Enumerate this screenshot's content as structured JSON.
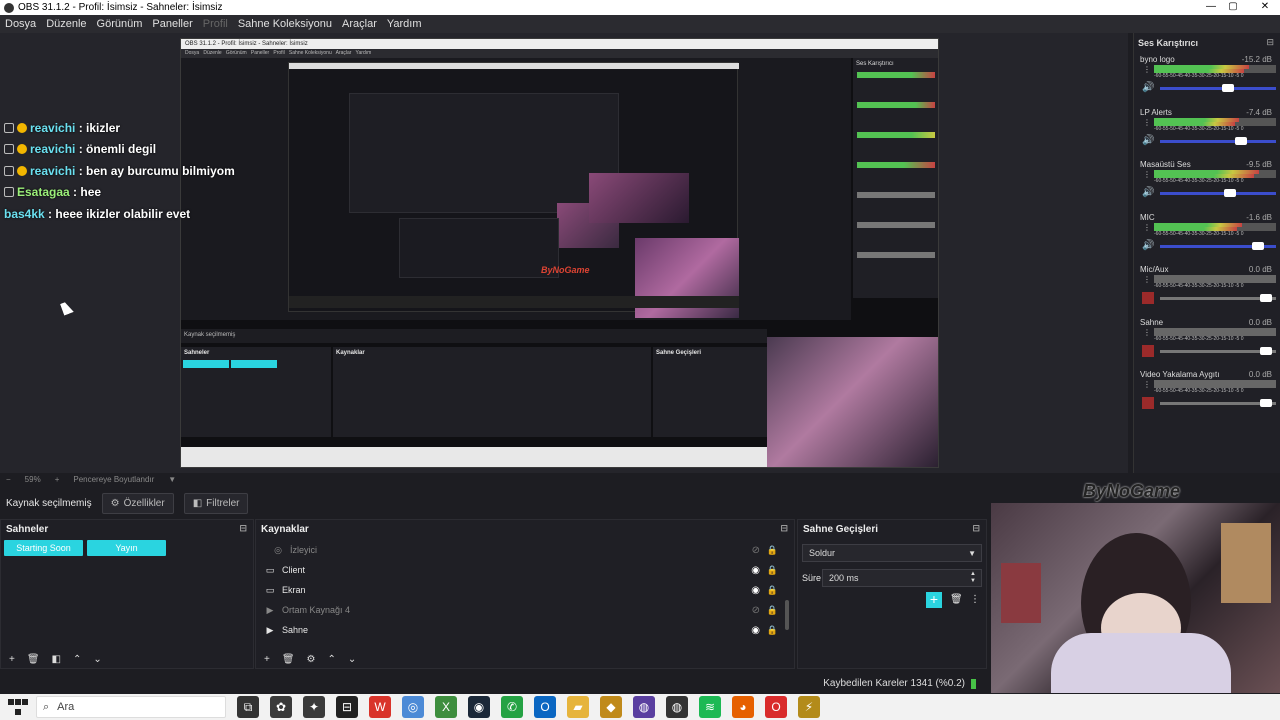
{
  "window": {
    "title": "OBS 31.1.2 - Profil: İsimsiz - Sahneler: İsimsiz",
    "controls": {
      "minimize": "—",
      "maximize": "▢",
      "close": "✕"
    }
  },
  "menu": {
    "items": [
      "Dosya",
      "Düzenle",
      "Görünüm",
      "Paneller",
      "Profil",
      "Sahne Koleksiyonu",
      "Araçlar",
      "Yardım"
    ]
  },
  "chat": [
    {
      "user": "reavichi",
      "text": ": ikizler"
    },
    {
      "user": "reavichi",
      "text": ": önemli degil"
    },
    {
      "user": "reavichi",
      "text": ": ben ay burcumu bilmiyom"
    },
    {
      "user": "Esatagaa",
      "text": ": hee"
    },
    {
      "user": "bas4kk",
      "text": ": heee ikizler olabilir evet"
    }
  ],
  "mixer": {
    "title": "Ses Karıştırıcı",
    "ticks": "-60-55-50-45-40-35-30-25-20-15-10 -5  0",
    "channels": [
      {
        "name": "byno logo",
        "db": "-15.2 dB",
        "level": 0.78,
        "volume": 0.6,
        "active": true
      },
      {
        "name": "LP Alerts",
        "db": "-7.4 dB",
        "level": 0.7,
        "volume": 0.72,
        "active": true
      },
      {
        "name": "Masaüstü Ses",
        "db": "-9.5 dB",
        "level": 0.86,
        "volume": 0.62,
        "active": true
      },
      {
        "name": "MIC",
        "db": "-1.6 dB",
        "level": 0.72,
        "volume": 0.88,
        "active": true
      },
      {
        "name": "Mic/Aux",
        "db": "0.0 dB",
        "level": 0.0,
        "volume": 0.96,
        "active": false
      },
      {
        "name": "Sahne",
        "db": "0.0 dB",
        "level": 0.0,
        "volume": 0.96,
        "active": false
      },
      {
        "name": "Video Yakalama Aygıtı",
        "db": "0.0 dB",
        "level": 0.0,
        "volume": 0.96,
        "active": false
      }
    ]
  },
  "zoom": {
    "level": "59%",
    "mode": "Pencereye Boyutlandır"
  },
  "source_bar": {
    "status": "Kaynak seçilmemiş",
    "properties": "Özellikler",
    "filters": "Filtreler"
  },
  "scenes": {
    "title": "Sahneler",
    "items": [
      "Starting Soon",
      "Yayın"
    ]
  },
  "sources": {
    "title": "Kaynaklar",
    "items": [
      {
        "name": "İzleyici",
        "icon": "◎",
        "visible": false
      },
      {
        "name": "Client",
        "icon": "▭",
        "visible": true
      },
      {
        "name": "Ekran",
        "icon": "▭",
        "visible": true
      },
      {
        "name": "Ortam Kaynağı 4",
        "icon": "▶",
        "visible": false
      },
      {
        "name": "Sahne",
        "icon": "▶",
        "visible": true
      }
    ]
  },
  "transitions": {
    "title": "Sahne Geçişleri",
    "type": "Soldur",
    "duration_label": "Süre",
    "duration": "200 ms"
  },
  "nested_labels": {
    "mixer_title": "Ses Karıştırıcı",
    "scenes_title": "Sahneler",
    "sources_title": "Kaynaklar",
    "transitions_title": "Sahne Geçişleri",
    "watermark": "ByNoGame"
  },
  "webcam": {
    "logo": "ByNoGame"
  },
  "status": {
    "dropped": "Kaybedilen Kareler 1341 (%0.2)"
  },
  "taskbar": {
    "search_placeholder": "Ara",
    "apps": [
      {
        "name": "task-view",
        "color": "#333",
        "glyph": "⧉"
      },
      {
        "name": "app-1",
        "color": "#3a3a3a",
        "glyph": "✿"
      },
      {
        "name": "app-2",
        "color": "#3a3a3a",
        "glyph": "✦"
      },
      {
        "name": "app-3",
        "color": "#222",
        "glyph": "⊟"
      },
      {
        "name": "app-4",
        "color": "#d9342b",
        "glyph": "W"
      },
      {
        "name": "app-5",
        "color": "#4c8ad6",
        "glyph": "◎"
      },
      {
        "name": "app-6",
        "color": "#3e8e3e",
        "glyph": "X"
      },
      {
        "name": "steam",
        "color": "#1b2838",
        "glyph": "◉"
      },
      {
        "name": "whatsapp",
        "color": "#25a244",
        "glyph": "✆"
      },
      {
        "name": "outlook",
        "color": "#0b67c2",
        "glyph": "O"
      },
      {
        "name": "files",
        "color": "#e6b43c",
        "glyph": "▰"
      },
      {
        "name": "app-7",
        "color": "#c08a1a",
        "glyph": "◆"
      },
      {
        "name": "obs-1",
        "color": "#5a3fa0",
        "glyph": "◍"
      },
      {
        "name": "obs-2",
        "color": "#333",
        "glyph": "◍"
      },
      {
        "name": "spotify",
        "color": "#1db954",
        "glyph": "≋"
      },
      {
        "name": "firefox",
        "color": "#e66000",
        "glyph": "◕"
      },
      {
        "name": "opera",
        "color": "#d92b2b",
        "glyph": "O"
      },
      {
        "name": "app-8",
        "color": "#b38b1a",
        "glyph": "⚡"
      }
    ]
  },
  "colors": {
    "accent": "#2ad4e0",
    "slider": "#3b4dcc",
    "panel": "#1f1f25",
    "meter_green": "#53c253"
  }
}
